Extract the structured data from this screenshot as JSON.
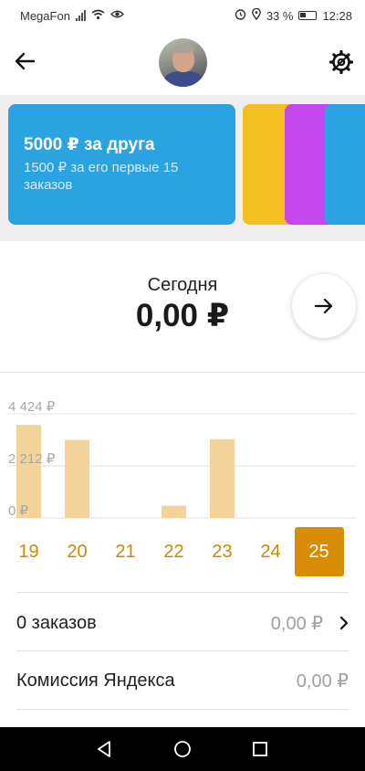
{
  "status_bar": {
    "carrier": "MegaFon",
    "battery_percent": "33 %",
    "time": "12:28",
    "icons": [
      "signal-icon",
      "wifi-icon",
      "eye-icon",
      "alarm-icon",
      "location-icon",
      "battery-icon"
    ]
  },
  "header": {
    "back_icon": "arrow-left-icon",
    "avatar": "user-avatar",
    "settings_icon": "settings-gear-icon"
  },
  "promo": {
    "title": "5000 ₽ за друга",
    "subtitle": "1500 ₽ за его первые 15 заказов",
    "card_colors": [
      "#2aa3e0",
      "#f5bf22",
      "#c548ee",
      "#2aa3e0"
    ]
  },
  "today": {
    "label": "Сегодня",
    "value": "0,00 ₽",
    "next_icon": "arrow-right-icon"
  },
  "chart_data": {
    "type": "bar",
    "categories": [
      "19",
      "20",
      "21",
      "22",
      "23",
      "24",
      "25"
    ],
    "values": [
      3950,
      3310,
      0,
      520,
      3350,
      0,
      0
    ],
    "ylim": [
      0,
      4424
    ],
    "yticks": [
      0,
      2212,
      4424
    ],
    "ytick_labels": [
      "0 ₽",
      "2 212 ₽",
      "4 424 ₽"
    ],
    "selected": "25",
    "bar_color": "#f2d49a",
    "grid": true
  },
  "summary": {
    "orders_label": "0 заказов",
    "orders_value": "0,00 ₽",
    "commission_label": "Комиссия Яндекса",
    "commission_value": "0,00 ₽"
  },
  "nav": {
    "icons": [
      "back-triangle-icon",
      "home-circle-icon",
      "recents-square-icon"
    ]
  },
  "colors": {
    "accent": "#d98d07",
    "day_text": "#c88a05",
    "promo_blue": "#2aa3e0"
  }
}
